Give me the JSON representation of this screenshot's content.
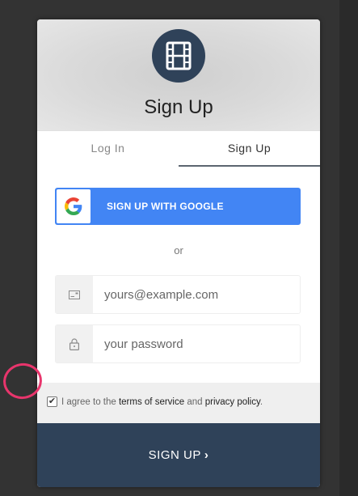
{
  "header": {
    "title": "Sign Up",
    "logo_icon": "film-icon",
    "logo_color": "#2f4259"
  },
  "tabs": [
    {
      "label": "Log In",
      "active": false
    },
    {
      "label": "Sign Up",
      "active": true
    }
  ],
  "google_button": {
    "label": "SIGN UP WITH GOOGLE",
    "color": "#4285f4"
  },
  "separator": "or",
  "email_field": {
    "placeholder": "yours@example.com",
    "icon": "envelope-icon"
  },
  "password_field": {
    "placeholder": "your password",
    "icon": "lock-icon"
  },
  "terms": {
    "checked": true,
    "prefix": "I agree to the ",
    "tos_link": "terms of service",
    "middle": " and ",
    "privacy_link": "privacy policy",
    "suffix": "."
  },
  "submit": {
    "label": "SIGN UP",
    "chevron": "›",
    "color": "#2f4259"
  }
}
